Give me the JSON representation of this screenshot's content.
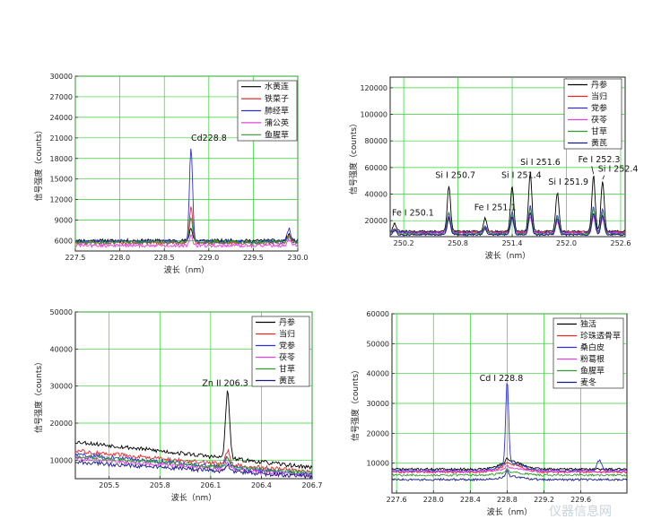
{
  "chart_data": [
    {
      "type": "line",
      "x_label": "波长（nm）",
      "y_label": "信号强度（counts）",
      "xlim": [
        227.5,
        230.0
      ],
      "ylim": [
        4500,
        30000
      ],
      "x_ticks": [
        "227.5",
        "228.0",
        "228.5",
        "229.0",
        "229.5",
        "230.0"
      ],
      "y_ticks": [
        "6000",
        "9000",
        "12000",
        "15000",
        "18000",
        "21000",
        "24000",
        "27000",
        "30000"
      ],
      "legend": [
        "水黄连",
        "铁菜子",
        "肺经草",
        "蒲公英",
        "鱼腥草"
      ],
      "colors": [
        "#000000",
        "#e8282b",
        "#2f2fd8",
        "#e040e0",
        "#2f9b2f"
      ],
      "peak_position": 228.8,
      "series_peaks": [
        7800,
        11000,
        19500,
        6800,
        9300
      ],
      "series_baselines": [
        6000,
        5700,
        5900,
        5300,
        5800
      ],
      "annotations": [
        {
          "text": "Cd228.8",
          "x": 228.8,
          "y": 20600
        }
      ],
      "grid": true
    },
    {
      "type": "line",
      "x_label": "波长（nm）",
      "y_label": "信号强度（counts）",
      "xlim": [
        250.05,
        252.65
      ],
      "ylim": [
        8000,
        128000
      ],
      "x_ticks": [
        "250.2",
        "250.8",
        "251.4",
        "252.0",
        "252.6"
      ],
      "y_ticks": [
        "20000",
        "40000",
        "60000",
        "80000",
        "100000",
        "120000"
      ],
      "legend": [
        "丹参",
        "当归",
        "党参",
        "茯苓",
        "甘草",
        "黄芪"
      ],
      "colors": [
        "#000000",
        "#e8282b",
        "#2f2fd8",
        "#e040e0",
        "#2f9b2f",
        "#1a1a8a"
      ],
      "peaks": [
        {
          "x": 250.1,
          "y": 18000
        },
        {
          "x": 250.7,
          "y": 46000
        },
        {
          "x": 251.1,
          "y": 22000
        },
        {
          "x": 251.4,
          "y": 46000
        },
        {
          "x": 251.6,
          "y": 56000
        },
        {
          "x": 251.9,
          "y": 41000
        },
        {
          "x": 252.3,
          "y": 54000
        },
        {
          "x": 252.4,
          "y": 50000
        }
      ],
      "annotations": [
        {
          "text": "Fe I 250.1",
          "x": 250.07,
          "y": 24000
        },
        {
          "text": "Si I 250.7",
          "x": 250.55,
          "y": 52000
        },
        {
          "text": "Fe I 251.1",
          "x": 250.98,
          "y": 28000
        },
        {
          "text": "Si I 251.4",
          "x": 251.28,
          "y": 52000
        },
        {
          "text": "Si I 251.6",
          "x": 251.49,
          "y": 62000
        },
        {
          "text": "Si I 251.9",
          "x": 251.8,
          "y": 47000
        },
        {
          "text": "Fe I 252.3",
          "x": 252.13,
          "y": 64000
        },
        {
          "text": "Si I 252.4",
          "x": 252.35,
          "y": 57000
        }
      ],
      "grid": true
    },
    {
      "type": "line",
      "x_label": "波长（nm）",
      "y_label": "信号强度（counts）",
      "xlim": [
        205.3,
        206.7
      ],
      "ylim": [
        5000,
        50000
      ],
      "x_ticks": [
        "205.5",
        "205.8",
        "206.1",
        "206.4",
        "206.7"
      ],
      "y_ticks": [
        "10000",
        "20000",
        "30000",
        "40000",
        "50000"
      ],
      "legend": [
        "丹参",
        "当归",
        "党参",
        "茯苓",
        "甘草",
        "黄芪"
      ],
      "colors": [
        "#000000",
        "#e8282b",
        "#2f2fd8",
        "#e040e0",
        "#2f9b2f",
        "#1a1a8a"
      ],
      "peak_position": 206.2,
      "series_peaks": [
        28500,
        12500,
        11000,
        9500,
        10500,
        9000
      ],
      "series_start": [
        15000,
        12500,
        11500,
        10500,
        11000,
        9500
      ],
      "series_end": [
        8000,
        6800,
        6200,
        5800,
        6500,
        5500
      ],
      "annotations": [
        {
          "text": "Zn II 206.3",
          "x": 206.05,
          "y": 30000
        }
      ],
      "grid": true
    },
    {
      "type": "line",
      "x_label": "波长（nm）",
      "y_label": "信号强度（counts）",
      "xlim": [
        227.55,
        230.1
      ],
      "ylim": [
        0,
        60000
      ],
      "x_ticks": [
        "227.6",
        "228.0",
        "228.4",
        "228.8",
        "229.2",
        "229.6"
      ],
      "y_ticks": [
        "10000",
        "20000",
        "30000",
        "40000",
        "50000",
        "60000"
      ],
      "legend": [
        "独活",
        "珍珠透骨草",
        "桑白皮",
        "粉葛根",
        "鱼腥草",
        "麦冬"
      ],
      "colors": [
        "#000000",
        "#e8282b",
        "#2f2fd8",
        "#e040e0",
        "#2f9b2f",
        "#1a1a8a"
      ],
      "peak_position": 228.8,
      "series_peaks": [
        9500,
        8000,
        35500,
        8500,
        7000,
        6500
      ],
      "series_baselines": [
        8000,
        7000,
        7500,
        7200,
        6000,
        4500
      ],
      "annotations": [
        {
          "text": "Cd I 228.8",
          "x": 228.5,
          "y": 37500
        }
      ],
      "grid": true
    }
  ],
  "watermark": "仪器信息网"
}
